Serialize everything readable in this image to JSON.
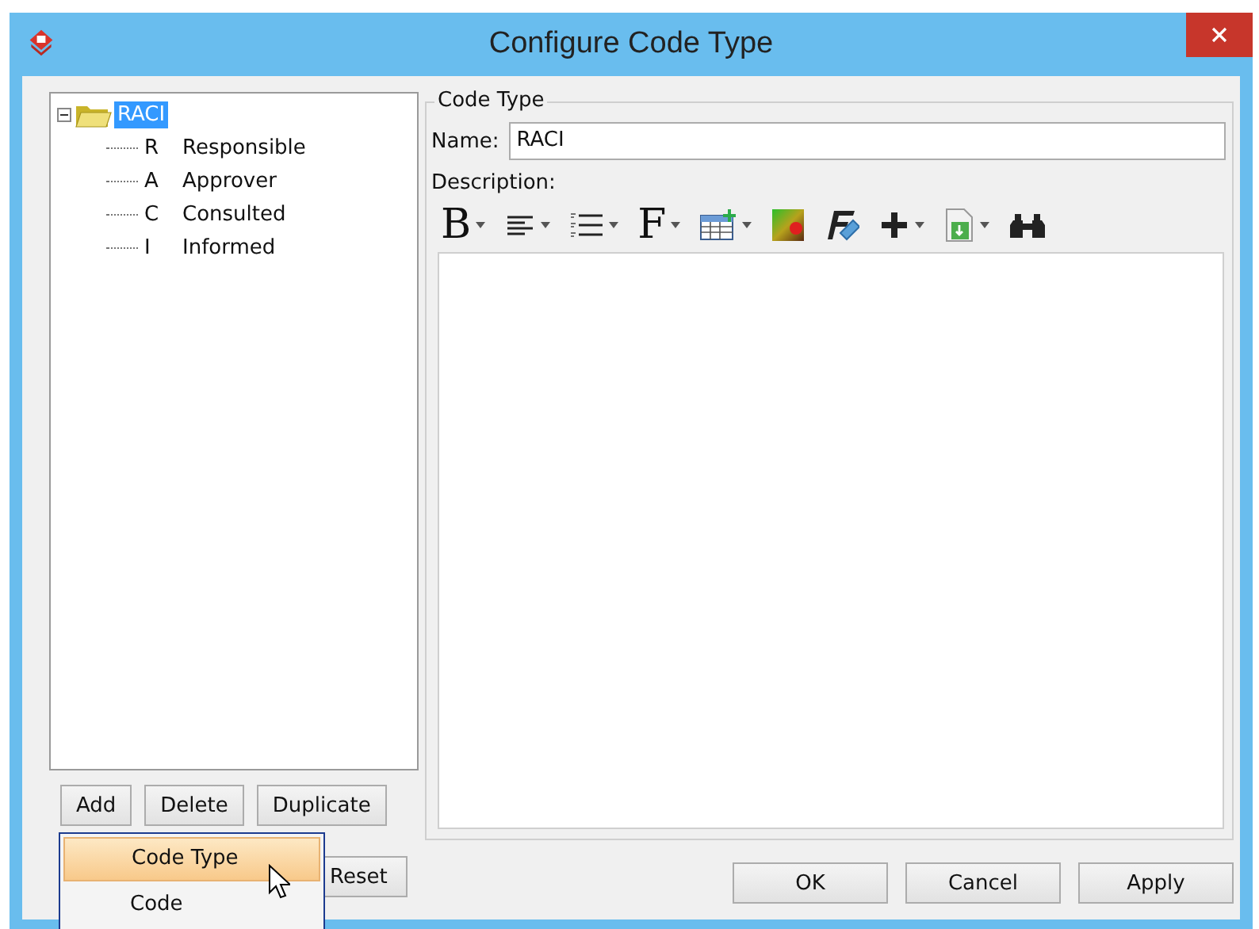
{
  "window": {
    "title": "Configure Code Type"
  },
  "tree": {
    "root": {
      "label": "RACI",
      "selected": true,
      "expanded": true,
      "children": [
        {
          "code": "R",
          "label": "Responsible",
          "selected": false
        },
        {
          "code": "A",
          "label": "Approver",
          "selected": false
        },
        {
          "code": "C",
          "label": "Consulted",
          "selected": false
        },
        {
          "code": "I",
          "label": "Informed",
          "selected": false
        }
      ]
    }
  },
  "tree_buttons": [
    "Add",
    "Delete",
    "Duplicate"
  ],
  "reset_button": "Reset",
  "group": {
    "title": "Code Type",
    "name_label": "Name:",
    "name_value": "RACI",
    "description_label": "Description:"
  },
  "toolbar": [
    {
      "kind": "glyph",
      "glyph": "B",
      "dropdown": true
    },
    {
      "kind": "align",
      "dropdown": true
    },
    {
      "kind": "list",
      "dropdown": true
    },
    {
      "kind": "glyph",
      "glyph": "F",
      "dropdown": true
    },
    {
      "kind": "table",
      "dropdown": true
    },
    {
      "kind": "color",
      "dropdown": false
    },
    {
      "kind": "eraser",
      "dropdown": false
    },
    {
      "kind": "plus",
      "dropdown": true
    },
    {
      "kind": "insert",
      "dropdown": true
    },
    {
      "kind": "find",
      "dropdown": false
    }
  ],
  "dialog_buttons": [
    "OK",
    "Cancel",
    "Apply"
  ],
  "popup_menu": [
    {
      "label": "Code Type",
      "selected": true
    },
    {
      "label": "Code",
      "selected": false
    }
  ]
}
